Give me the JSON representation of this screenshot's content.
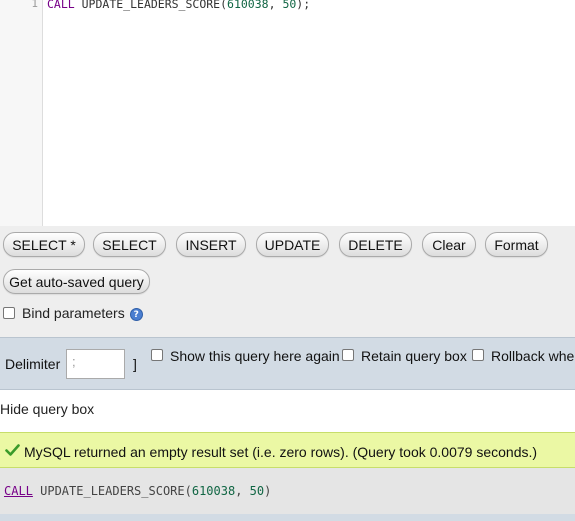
{
  "editor": {
    "line_number": "1",
    "tokens": {
      "keyword": "CALL",
      "procedure": " UPDATE_LEADERS_SCORE(",
      "arg1": "610038",
      "sep": ", ",
      "arg2": "50",
      "end": ");"
    }
  },
  "toolbar": {
    "buttons": [
      "SELECT *",
      "SELECT",
      "INSERT",
      "UPDATE",
      "DELETE",
      "Clear",
      "Format"
    ],
    "autosaved_label": "Get auto-saved query",
    "bind_label": "Bind parameters"
  },
  "options": {
    "delimiter_label": "Delimiter",
    "delimiter_value": ";",
    "bracket": "]",
    "show_query_label": "Show this query here again",
    "retain_label": "Retain query box",
    "rollback_label": "Rollback when"
  },
  "hide_query_label": "Hide query box",
  "success": {
    "message": "MySQL returned an empty result set (i.e. zero rows). (Query took 0.0079 seconds.)"
  },
  "sql": {
    "keyword": "CALL",
    "procedure": " UPDATE_LEADERS_SCORE(",
    "arg1": "610038",
    "sep": ", ",
    "arg2": "50",
    "end": ")"
  },
  "colors": {
    "keyword": "#770088",
    "number": "#116644",
    "success_bg": "#ebf8a4",
    "options_bg": "#d2dbe4"
  }
}
